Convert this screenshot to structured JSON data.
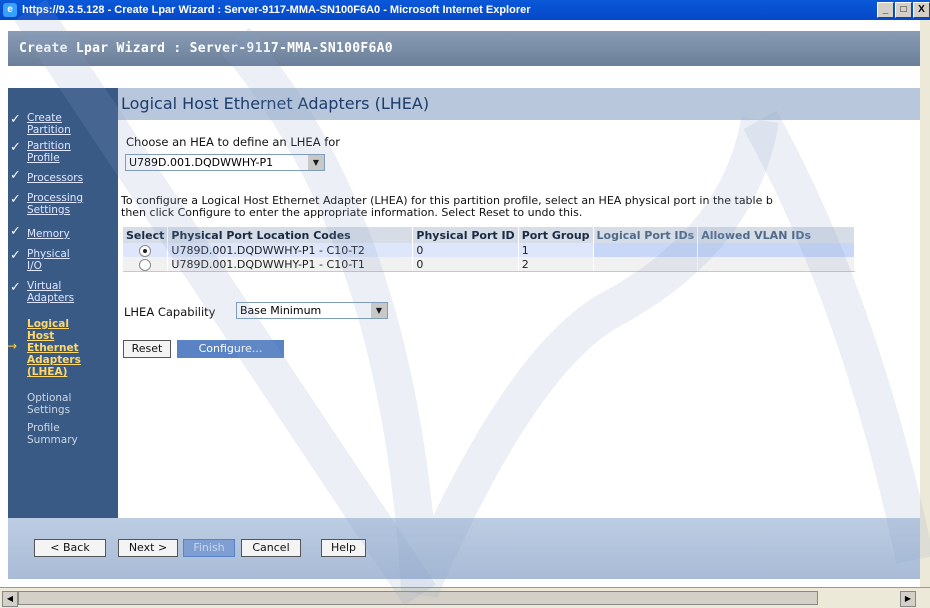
{
  "window": {
    "title": "https://9.3.5.128 - Create Lpar Wizard : Server-9117-MMA-SN100F6A0 - Microsoft Internet Explorer",
    "minimize": "_",
    "maximize": "□",
    "close": "X"
  },
  "app": {
    "header": "Create Lpar Wizard : Server-9117-MMA-SN100F6A0"
  },
  "nav": {
    "items": [
      {
        "label_line1": "Create",
        "label_line2": "Partition",
        "state": "done"
      },
      {
        "label_line1": "Partition",
        "label_line2": "Profile",
        "state": "done"
      },
      {
        "label_line1": "Processors",
        "label_line2": "",
        "state": "done"
      },
      {
        "label_line1": "Processing",
        "label_line2": "Settings",
        "state": "done"
      },
      {
        "label_line1": "Memory",
        "label_line2": "",
        "state": "done"
      },
      {
        "label_line1": "Physical",
        "label_line2": "I/O",
        "state": "done"
      },
      {
        "label_line1": "Virtual",
        "label_line2": "Adapters",
        "state": "done"
      },
      {
        "label_line1": "Logical",
        "label_line2": "Host",
        "label_line3": "Ethernet",
        "label_line4": "Adapters",
        "label_line5": "(LHEA)",
        "state": "current"
      },
      {
        "label_line1": "Optional",
        "label_line2": "Settings",
        "state": "todo"
      },
      {
        "label_line1": "Profile",
        "label_line2": "Summary",
        "state": "todo"
      }
    ]
  },
  "page": {
    "title": "Logical Host Ethernet Adapters (LHEA)",
    "choose_label": "Choose an HEA to define an LHEA for",
    "hea_select": "U789D.001.DQDWWHY-P1",
    "description_line1": "To configure a Logical Host Ethernet Adapter (LHEA) for this partition profile, select an HEA physical port in the table b",
    "description_line2": "then click Configure to enter the appropriate information. Select Reset to undo this.",
    "table": {
      "headers": [
        "Select",
        "Physical Port Location Codes",
        "Physical Port ID",
        "Port Group",
        "Logical Port IDs",
        "Allowed VLAN IDs"
      ],
      "rows": [
        {
          "location": "U789D.001.DQDWWHY-P1 - C10-T2",
          "port_id": "0",
          "group": "1",
          "logical": "",
          "vlan": "",
          "selected": true
        },
        {
          "location": "U789D.001.DQDWWHY-P1 - C10-T1",
          "port_id": "0",
          "group": "2",
          "logical": "",
          "vlan": "",
          "selected": false
        }
      ]
    },
    "capability_label": "LHEA Capability",
    "capability_value": "Base Minimum",
    "reset": "Reset",
    "configure": "Configure..."
  },
  "footer": {
    "back": "< Back",
    "next": "Next >",
    "finish": "Finish",
    "cancel": "Cancel",
    "help": "Help"
  },
  "colors": {
    "titlebar": "#0648c8",
    "nav_bg": "#3a5a86",
    "accent": "#5a83c6"
  }
}
